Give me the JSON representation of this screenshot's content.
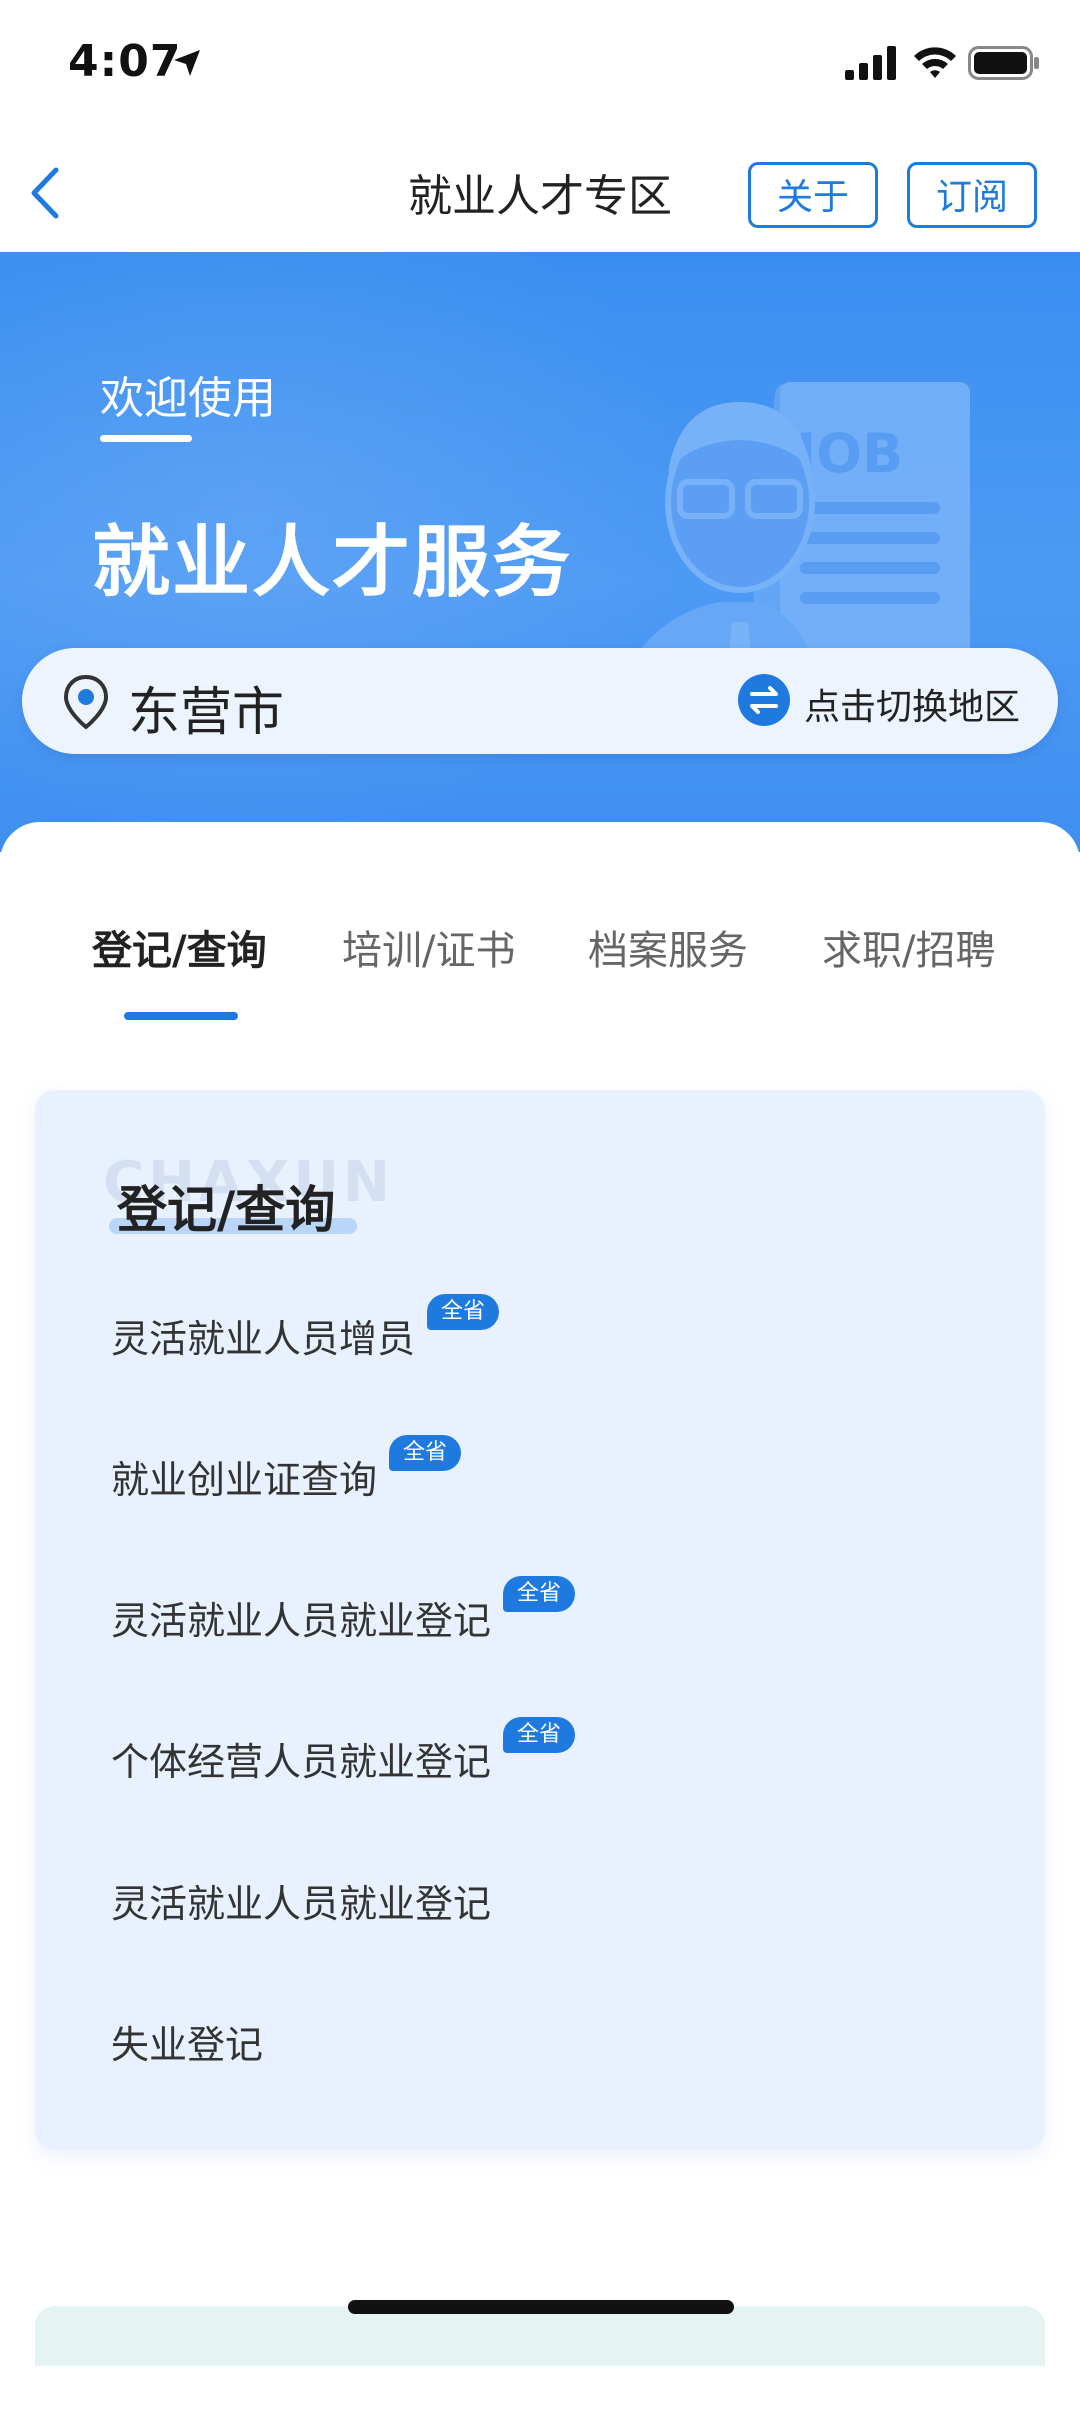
{
  "status": {
    "time": "4:07"
  },
  "nav": {
    "title": "就业人才专区",
    "about": "关于",
    "subscribe": "订阅"
  },
  "hero": {
    "welcome": "欢迎使用",
    "heading": "就业人才服务",
    "illustration_text": "JOB"
  },
  "location": {
    "city": "东营市",
    "switch_label": "点击切换地区"
  },
  "tabs": [
    {
      "label": "登记/查询",
      "active": true
    },
    {
      "label": "培训/证书",
      "active": false
    },
    {
      "label": "档案服务",
      "active": false
    },
    {
      "label": "求职/招聘",
      "active": false
    }
  ],
  "panel": {
    "watermark": "CHAXUN",
    "title": "登记/查询",
    "items": [
      {
        "label": "灵活就业人员增员",
        "badge": "全省"
      },
      {
        "label": "就业创业证查询",
        "badge": "全省"
      },
      {
        "label": "灵活就业人员就业登记",
        "badge": "全省"
      },
      {
        "label": "个体经营人员就业登记",
        "badge": "全省"
      },
      {
        "label": "灵活就业人员就业登记",
        "badge": ""
      },
      {
        "label": "失业登记",
        "badge": ""
      }
    ]
  },
  "colors": {
    "accent": "#1f7ae0",
    "hero": "#3a8ef0",
    "panel": "#e8f1fd"
  }
}
